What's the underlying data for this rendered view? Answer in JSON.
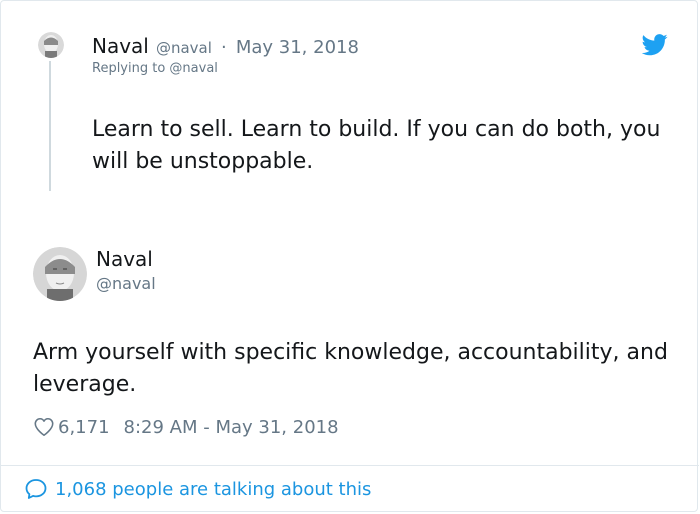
{
  "parent_tweet": {
    "name": "Naval",
    "handle": "@naval",
    "separator": "·",
    "date": "May 31, 2018",
    "replying_to": "Replying to @naval",
    "text": "Learn to sell. Learn to build. If you can do both, you will be unstoppable."
  },
  "main_tweet": {
    "name": "Naval",
    "handle": "@naval",
    "text": "Arm yourself with specific knowledge, accountability, and leverage.",
    "likes": "6,171",
    "timestamp": "8:29 AM - May 31, 2018"
  },
  "footer": {
    "talking": "1,068 people are talking about this"
  },
  "icons": {
    "brand": "twitter-bird-icon",
    "like": "heart-icon",
    "reply": "speech-bubble-icon"
  },
  "colors": {
    "brand_blue": "#1da1f2",
    "link_blue": "#1b95e0",
    "text": "#14171a",
    "muted": "#657786",
    "border": "#e1e8ed"
  }
}
